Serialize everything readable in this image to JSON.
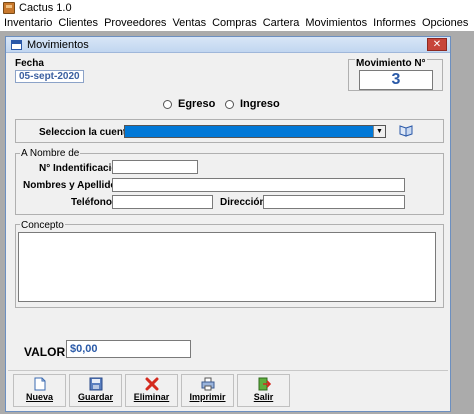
{
  "app": {
    "title": "Cactus 1.0"
  },
  "menu": [
    "Inventario",
    "Clientes",
    "Proveedores",
    "Ventas",
    "Compras",
    "Cartera",
    "Movimientos",
    "Informes",
    "Opciones"
  ],
  "form": {
    "title": "Movimientos",
    "close_label": "✕",
    "fecha_label": "Fecha",
    "fecha_value": "05-sept-2020",
    "movimiento_label": "Movimiento N°",
    "movimiento_value": "3",
    "radio_egreso": "Egreso",
    "radio_ingreso": "Ingreso",
    "cuenta_label": "Seleccion la cuenta",
    "nombre_group": "A Nombre de",
    "identificacion_label": "N° Indentificación:",
    "nombres_label": "Nombres y Apellidos:",
    "telefono_label": "Teléfono:",
    "direccion_label": "Dirección:",
    "concepto_group": "Concepto",
    "valor_label": "VALOR:",
    "valor_value": "$0,00"
  },
  "toolbar": {
    "nueva": "Nueva",
    "guardar": "Guardar",
    "eliminar": "Eliminar",
    "imprimir": "Imprimir",
    "salir": "Salir"
  }
}
